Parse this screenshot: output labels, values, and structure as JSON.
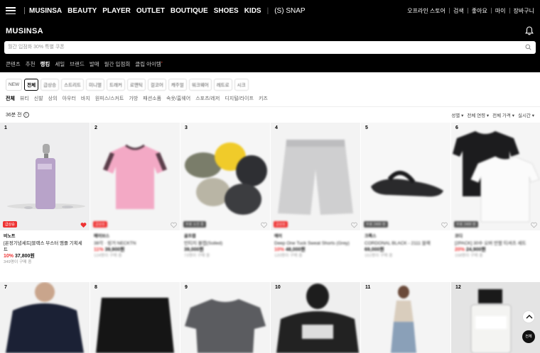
{
  "topbar": {
    "nav": [
      "MUSINSA",
      "BEAUTY",
      "PLAYER",
      "OUTLET",
      "BOUTIQUE",
      "SHOES",
      "KIDS",
      "(S) SNAP"
    ],
    "right": [
      "오프라인 스토어",
      "검색",
      "좋아요",
      "마이",
      "장바구니"
    ]
  },
  "header": {
    "logo": "MUSINSA",
    "search_placeholder": "월간 입점화 30% 특별 쿠폰",
    "subnav": [
      "콘텐츠",
      "추천",
      "랭킹",
      "세일",
      "브랜드",
      "발매",
      "월간 입점회",
      "클립 아이템"
    ],
    "subnav_active": "랭킹"
  },
  "category_chips": [
    "NEW",
    "전체",
    "급상승",
    "스트리트",
    "미니멀",
    "트래커",
    "로맨틱",
    "걸코어",
    "캐주얼",
    "워크웨어",
    "레트로",
    "시크"
  ],
  "category_chip_selected": "전체",
  "category_tabs": [
    "전체",
    "뷰티",
    "신발",
    "상의",
    "아우터",
    "바지",
    "원피스/스커트",
    "가방",
    "패션소품",
    "속옷/홈웨어",
    "스포츠/레저",
    "디지털/라이프",
    "키즈"
  ],
  "category_tab_selected": "전체",
  "updated_text": "36분 전",
  "filters": [
    "성별",
    "전체 연령",
    "전체 가격",
    "실시간"
  ],
  "products": [
    {
      "rank": "1",
      "badge": "급상승",
      "brand": "비노트",
      "name": "[온정기념세트]블랙스 부스터 앰플 기획세트",
      "discount": "10%",
      "price": "37,800원",
      "meta": "349명이 구매 중",
      "liked": true
    },
    {
      "rank": "2",
      "badge": "급상승",
      "brand": "메이브스",
      "name": "38각 · 링거 NECKTN",
      "discount": "11%",
      "price": "39,900원",
      "meta": "124명이 구매 중",
      "liked": false
    },
    {
      "rank": "3",
      "badge": "무료 소진 중",
      "brand": "골프캡",
      "name": "빈티지 볼캡(Soiled)",
      "discount": "",
      "price": "39,000원",
      "meta": "73명이 구매 중",
      "liked": false
    },
    {
      "rank": "4",
      "badge": "급상승",
      "brand": "에이",
      "name": "Deep One Tuck Sweat Shorts (Grey)",
      "discount": "10%",
      "price": "48,000원",
      "meta": "120명이 구매 중",
      "liked": false
    },
    {
      "rank": "5",
      "badge": "무료 2400 원",
      "brand": "크록스",
      "name": "CORDONAL BLACK - 2111 블랙",
      "discount": "",
      "price": "69,000원",
      "meta": "151명이 구매 중",
      "liked": false
    },
    {
      "rank": "6",
      "badge": "무료 2400 원",
      "brand": "코디",
      "name": "[2PACK] 30수 오버 반팔 티셔츠 세트",
      "discount": "20%",
      "price": "24,900원",
      "meta": "158명이 구매 중",
      "liked": false
    },
    {
      "rank": "7"
    },
    {
      "rank": "8"
    },
    {
      "rank": "9"
    },
    {
      "rank": "10"
    },
    {
      "rank": "11"
    },
    {
      "rank": "12"
    }
  ],
  "fab_all": "전체"
}
